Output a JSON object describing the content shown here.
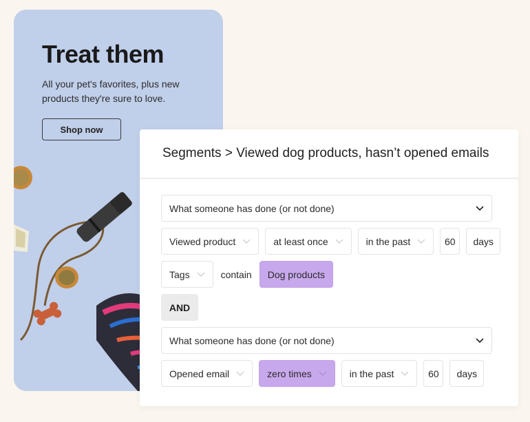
{
  "promo": {
    "title": "Treat them",
    "subtitle": "All your pet's favorites, plus new products they're sure to love.",
    "button_label": "Shop now",
    "background_color": "#c0cfea",
    "photo_items": [
      "dog-treat",
      "dog-whistle",
      "leash-cord",
      "bone-biscuit",
      "rope-toy",
      "gift-card"
    ]
  },
  "segment": {
    "breadcrumb_root": "Segments",
    "breadcrumb_separator": ">",
    "segment_name": "Viewed dog products, hasn’t opened emails",
    "conditions": [
      {
        "type_label": "What someone has done (or not done)",
        "action": "Viewed product",
        "frequency": "at least once",
        "timeframe": "in the past",
        "count": "60",
        "unit": "days",
        "filter": {
          "property": "Tags",
          "operator": "contain",
          "value": "Dog products"
        }
      },
      {
        "type_label": "What someone has done (or not done)",
        "action": "Opened email",
        "frequency": "zero times",
        "timeframe": "in the past",
        "count": "60",
        "unit": "days"
      }
    ],
    "joiner": "AND",
    "highlight_color": "#c8a8ec"
  }
}
